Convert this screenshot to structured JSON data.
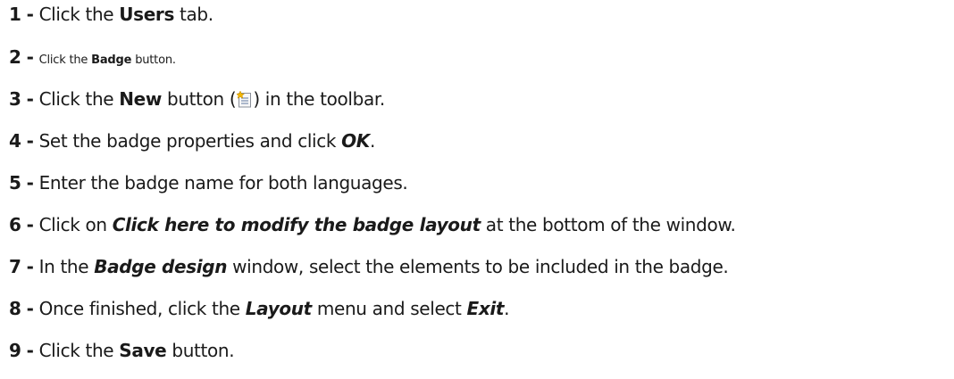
{
  "steps": [
    {
      "number": "1",
      "separator": "-",
      "parts": [
        "Click the ",
        "Users",
        " tab."
      ]
    },
    {
      "number": "2",
      "separator": "-",
      "parts": [
        "Click the ",
        "Badge",
        " button."
      ]
    },
    {
      "number": "3",
      "separator": "-",
      "parts": [
        "Click the ",
        "New",
        " button (",
        ") in the toolbar."
      ],
      "icon": "new-document-icon"
    },
    {
      "number": "4",
      "separator": "-",
      "parts": [
        "Set the badge properties and click ",
        "OK",
        "."
      ]
    },
    {
      "number": "5",
      "separator": "-",
      "parts": [
        "Enter the badge name for both languages."
      ]
    },
    {
      "number": "6",
      "separator": "-",
      "parts": [
        "Click on ",
        "Click here to modify the badge layout",
        " at the bottom of the window."
      ]
    },
    {
      "number": "7",
      "separator": "-",
      "parts": [
        "In the ",
        "Badge design",
        " window, select the elements to be included in the badge."
      ]
    },
    {
      "number": "8",
      "separator": "-",
      "parts": [
        "Once finished, click the ",
        "Layout",
        " menu and select ",
        "Exit",
        "."
      ]
    },
    {
      "number": "9",
      "separator": "-",
      "parts": [
        "Click the ",
        "Save",
        " button."
      ]
    }
  ]
}
